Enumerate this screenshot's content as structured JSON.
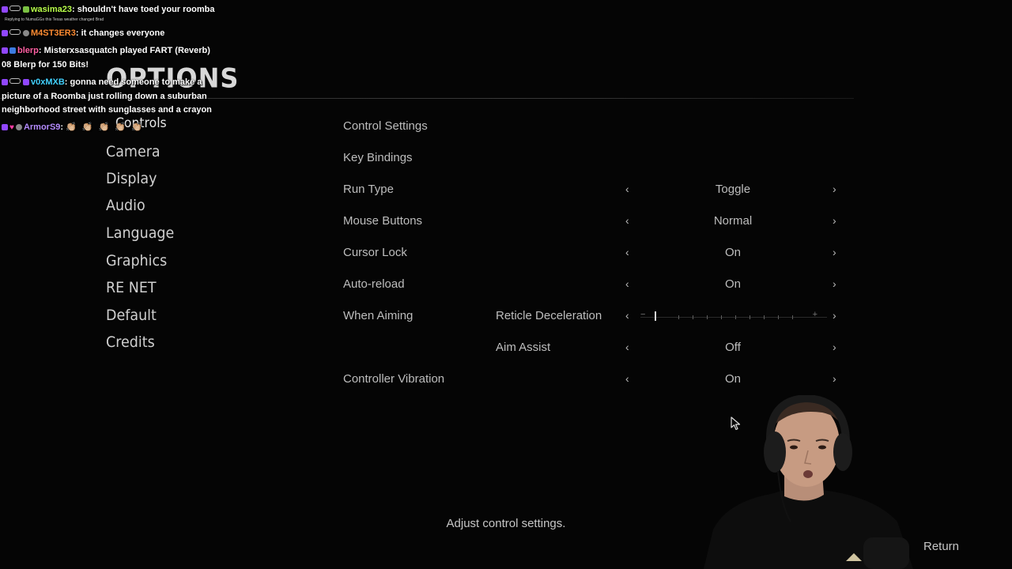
{
  "menu": {
    "title": "OPTIONS",
    "nav": [
      {
        "label": "Controls",
        "active": true
      },
      {
        "label": "Camera"
      },
      {
        "label": "Display"
      },
      {
        "label": "Audio"
      },
      {
        "label": "Language"
      },
      {
        "label": "Graphics"
      },
      {
        "label": "RE NET"
      },
      {
        "label": "Default"
      },
      {
        "label": "Credits"
      }
    ]
  },
  "settings": {
    "control_settings": "Control Settings",
    "key_bindings": "Key Bindings",
    "run_type": {
      "label": "Run Type",
      "value": "Toggle"
    },
    "mouse_buttons": {
      "label": "Mouse Buttons",
      "value": "Normal"
    },
    "cursor_lock": {
      "label": "Cursor Lock",
      "value": "On"
    },
    "auto_reload": {
      "label": "Auto-reload",
      "value": "On"
    },
    "when_aiming": {
      "label": "When Aiming",
      "reticle_deceleration": {
        "label": "Reticle Deceleration",
        "level": 0.0
      },
      "aim_assist": {
        "label": "Aim Assist",
        "value": "Off"
      }
    },
    "controller_vibration": {
      "label": "Controller Vibration",
      "value": "On"
    },
    "arrow_left": "‹",
    "arrow_right": "›",
    "slider_minus": "−",
    "slider_plus": "+"
  },
  "footer": {
    "description": "Adjust control settings.",
    "return_label": "Return"
  },
  "chat": [
    {
      "user": "wasima23",
      "color": "#b8ff4a",
      "text": "shouldn't have toed your roomba"
    },
    {
      "reply": "Replying to NumaGGs this Texas weather changed Brad"
    },
    {
      "user": "M4ST3ER3",
      "color": "#ff8c32",
      "text": "it changes everyone"
    },
    {
      "user": "blerp",
      "color": "#ff5fa2",
      "text": "Misterxsasquatch played FART (Reverb) 08 Blerp for 150 Bits!"
    },
    {
      "user": "v0xMXB",
      "color": "#42d2ff",
      "text": "gonna need someone to make a picture of a Roomba just rolling down a suburban neighborhood street with sunglasses and a crayon"
    },
    {
      "user": "ArmorS9",
      "color": "#b58cff",
      "text": "👏🏼 👏🏼 👏🏼 👏🏼 👏🏼"
    }
  ]
}
